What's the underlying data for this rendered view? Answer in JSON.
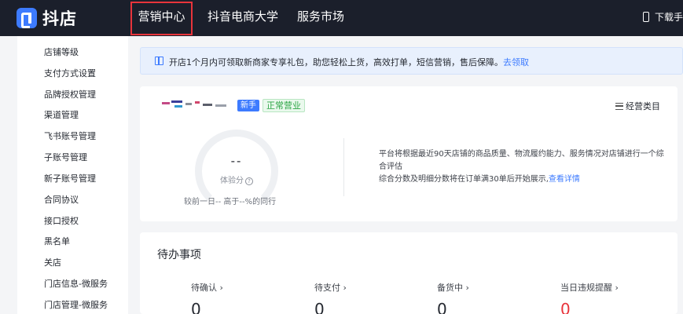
{
  "header": {
    "logo_text": "抖店",
    "nav": [
      "营销中心",
      "抖音电商大学",
      "服务市场"
    ],
    "right_text": "下载手"
  },
  "sidebar": {
    "items": [
      "店铺等级",
      "支付方式设置",
      "品牌授权管理",
      "渠道管理",
      "飞书账号管理",
      "子账号管理",
      "新子账号管理",
      "合同协议",
      "接口授权",
      "黑名单",
      "关店",
      "门店信息-微服务",
      "门店管理-微服务"
    ]
  },
  "notice": {
    "text": "开店1个月内可领取新商家专享礼包，助您轻松上货，高效打单，短信营销，售后保障。",
    "link": "去领取"
  },
  "shop": {
    "badge_new": "新手",
    "status": "正常营业",
    "category_link": "经营类目",
    "score_value": "--",
    "score_label": "体验分",
    "help_glyph": "?",
    "compare_text": "较前一日--   高于--%的同行",
    "desc_line1": "平台将根据最近90天店铺的商品质量、物流履约能力、服务情况对店铺进行一个综合评估",
    "desc_line2": "综合分数及明细分数将在订单满30单后开始展示,",
    "desc_link": "查看详情"
  },
  "todo": {
    "title": "待办事项",
    "items": [
      {
        "label": "待确认 ›",
        "value": "0"
      },
      {
        "label": "待支付 ›",
        "value": "0"
      },
      {
        "label": "备货中 ›",
        "value": "0"
      },
      {
        "label": "当日违规提醒 ›",
        "value": "0"
      }
    ]
  },
  "colors": {
    "topbar": "#1b1f2b",
    "accent": "#3d7bff",
    "highlight_box": "#e8343b",
    "status_green": "#2ca545",
    "alert_red": "#e8343b"
  }
}
